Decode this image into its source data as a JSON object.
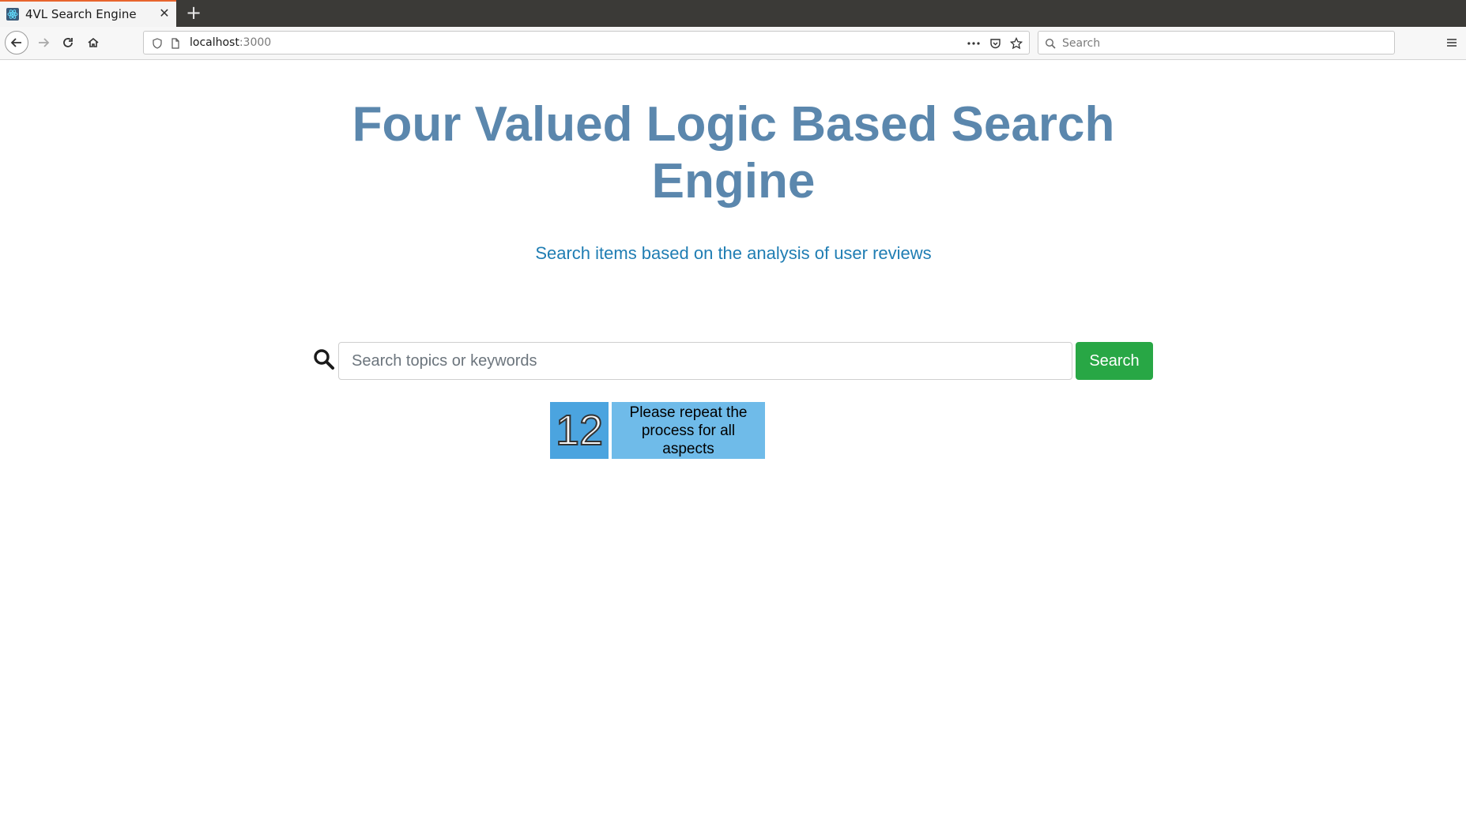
{
  "browser": {
    "tab": {
      "title": "4VL Search Engine"
    },
    "newtab_label": "+",
    "url": {
      "host": "localhost",
      "port": ":3000"
    },
    "search_placeholder": "Search",
    "menu_label": "☰"
  },
  "header": {
    "title": "Four Valued Logic Based Search Engine",
    "subtitle": "Search items based on the analysis of user reviews"
  },
  "search": {
    "placeholder": "Search topics or keywords",
    "button_label": "Search"
  },
  "instruction": {
    "step_number": "12",
    "text": "Please repeat the process for all aspects"
  },
  "colors": {
    "title": "#5b87ad",
    "subtitle": "#1f7db3",
    "search_button": "#28a745",
    "step_badge": "#4ba4df",
    "step_text_bg": "#6fbbe9"
  },
  "icons": {
    "tab": "react-favicon-icon",
    "close": "close-icon",
    "back": "back-arrow-icon",
    "forward": "forward-arrow-icon",
    "reload": "reload-icon",
    "home": "home-icon",
    "shield": "shield-icon",
    "page": "page-icon",
    "more": "more-dots-icon",
    "pocket": "pocket-icon",
    "bookmark": "star-icon",
    "browser_search": "search-icon",
    "menu": "hamburger-menu-icon",
    "main_search": "magnifier-icon"
  }
}
